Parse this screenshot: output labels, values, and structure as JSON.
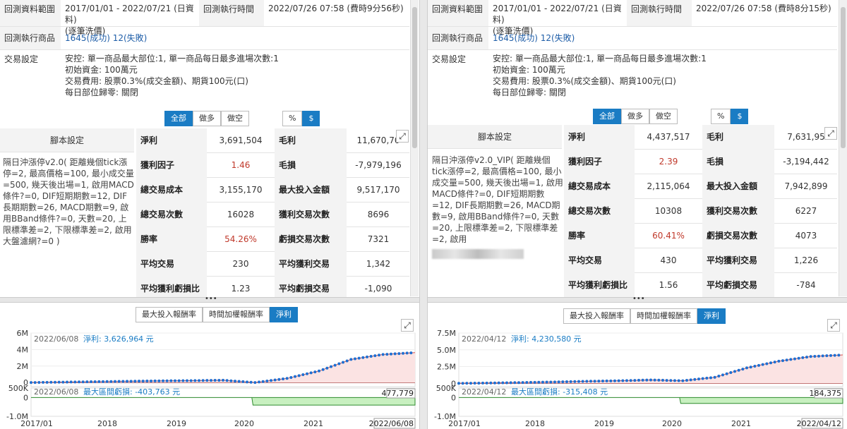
{
  "left": {
    "info": {
      "range_label": "回測資料範圍",
      "range_value": "2017/01/01 - 2022/07/21 (日資料)",
      "range_sub": "(逐筆洗價)",
      "exec_time_label": "回測執行時間",
      "exec_time_value": "2022/07/26 07:58 (費時9分56秒)",
      "products_label": "回測執行商品",
      "products_success": "1645(成功)",
      "products_fail": "12(失敗)",
      "trade_label": "交易設定",
      "trade_lines": [
        "安控: 單一商品最大部位:1, 單一商品每日最多進場次數:1",
        "初始資金: 100萬元",
        "交易費用: 股票0.3%(成交金額)、期貨100元(口)",
        "每日部位歸零: 關閉"
      ]
    },
    "filters": {
      "all": "全部",
      "long": "做多",
      "short": "做空",
      "percent": "%",
      "dollar": "$"
    },
    "script_header": "腳本設定",
    "script_desc": "隔日沖漲停v2.0( 距離幾個tick漲停=2, 最高價格=100, 最小成交量=500, 幾天後出場=1, 啟用MACD條件?=0, DIF短期期數=12, DIF長期期數=26, MACD期數=9, 啟用BBand條件?=0, 天數=20, 上限標準差=2, 下限標準差=2, 啟用大盤濾網?=0 )",
    "stats": [
      {
        "l1": "淨利",
        "v1": "3,691,504",
        "l2": "毛利",
        "v2": "11,670,70"
      },
      {
        "l1": "獲利因子",
        "v1": "1.46",
        "l2": "毛損",
        "v2": "-7,979,196"
      },
      {
        "l1": "總交易成本",
        "v1": "3,155,170",
        "l2": "最大投入金額",
        "v2": "9,517,170"
      },
      {
        "l1": "總交易次數",
        "v1": "16028",
        "l2": "獲利交易次數",
        "v2": "8696"
      },
      {
        "l1": "勝率",
        "v1": "54.26%",
        "l2": "虧損交易次數",
        "v2": "7321"
      },
      {
        "l1": "平均交易",
        "v1": "230",
        "l2": "平均獲利交易",
        "v2": "1,342"
      },
      {
        "l1": "平均獲利虧損比",
        "v1": "1.23",
        "l2": "平均虧損交易",
        "v2": "-1,090"
      }
    ],
    "chart_tabs": [
      "最大投入報酬率",
      "時間加權報酬率",
      "淨利"
    ],
    "top_legend_date": "2022/06/08",
    "top_legend_text": "淨利: 3,626,964 元",
    "bottom_legend_date": "2022/06/08",
    "bottom_legend_text": "最大區間虧損: -403,763 元",
    "dd_label": "477,779",
    "x_end_label": "2022/06/08"
  },
  "right": {
    "info": {
      "range_label": "回測資料範圍",
      "range_value": "2017/01/01 - 2022/07/21 (日資料)",
      "range_sub": "(逐筆洗價)",
      "exec_time_label": "回測執行時間",
      "exec_time_value": "2022/07/26 07:58 (費時8分15秒)",
      "products_label": "回測執行商品",
      "products_success": "1645(成功)",
      "products_fail": "12(失敗)",
      "trade_label": "交易設定",
      "trade_lines": [
        "安控: 單一商品最大部位:1, 單一商品每日最多進場次數:1",
        "初始資金: 100萬元",
        "交易費用: 股票0.3%(成交金額)、期貨100元(口)",
        "每日部位歸零: 關閉"
      ]
    },
    "filters": {
      "all": "全部",
      "long": "做多",
      "short": "做空",
      "percent": "%",
      "dollar": "$"
    },
    "script_header": "腳本設定",
    "script_desc": "隔日沖漲停v2.0_VIP( 距離幾個tick漲停=2, 最高價格=100, 最小成交量=500, 幾天後出場=1, 啟用MACD條件?=0, DIF短期期數=12, DIF長期期數=26, MACD期數=9, 啟用BBand條件?=0, 天數=20, 上限標準差=2, 下限標準差=2, 啟用",
    "stats": [
      {
        "l1": "淨利",
        "v1": "4,437,517",
        "l2": "毛利",
        "v2": "7,631,95"
      },
      {
        "l1": "獲利因子",
        "v1": "2.39",
        "l2": "毛損",
        "v2": "-3,194,442"
      },
      {
        "l1": "總交易成本",
        "v1": "2,115,064",
        "l2": "最大投入金額",
        "v2": "7,942,899"
      },
      {
        "l1": "總交易次數",
        "v1": "10308",
        "l2": "獲利交易次數",
        "v2": "6227"
      },
      {
        "l1": "勝率",
        "v1": "60.41%",
        "l2": "虧損交易次數",
        "v2": "4073"
      },
      {
        "l1": "平均交易",
        "v1": "430",
        "l2": "平均獲利交易",
        "v2": "1,226"
      },
      {
        "l1": "平均獲利虧損比",
        "v1": "1.56",
        "l2": "平均虧損交易",
        "v2": "-784"
      }
    ],
    "chart_tabs": [
      "最大投入報酬率",
      "時間加權報酬率",
      "淨利"
    ],
    "top_legend_date": "2022/04/12",
    "top_legend_text": "淨利: 4,230,580 元",
    "bottom_legend_date": "2022/04/12",
    "bottom_legend_text": "最大區間虧損: -315,408 元",
    "dd_label": "184,375",
    "x_end_label": "2022/04/12"
  },
  "colors": {
    "accent": "#1a7cc4",
    "link": "#1f5ea8",
    "red": "#c0392b",
    "equity": "#1f6fd1",
    "drawdown_fill": "#c8f0c0",
    "drawdown_line": "#2e8b2e"
  },
  "chart_data": [
    {
      "type": "line",
      "x": [
        "2017/01",
        "2017/07",
        "2018/01",
        "2018/07",
        "2019/01",
        "2019/07",
        "2020/01",
        "2020/04",
        "2020/07",
        "2021/01",
        "2021/07",
        "2022/01",
        "2022/06"
      ],
      "series": [
        {
          "name": "淨利",
          "values": [
            0,
            50000,
            100000,
            150000,
            200000,
            230000,
            280000,
            0,
            500000,
            1400000,
            2800000,
            3400000,
            3626964
          ]
        }
      ],
      "y_ticks": [
        "6M",
        "4M",
        "2M",
        "0"
      ],
      "x_ticks": [
        "2017/01",
        "2018",
        "2019",
        "2020",
        "2021",
        "2022/06/08"
      ],
      "ylim": [
        -500000,
        6000000
      ]
    },
    {
      "type": "area",
      "x": [
        "2017/01",
        "2020/03",
        "2020/04",
        "2022/06"
      ],
      "series": [
        {
          "name": "最大區間虧損",
          "values": [
            0,
            0,
            -403763,
            -403763
          ]
        }
      ],
      "y_ticks": [
        "500K",
        "0",
        "-1.0M"
      ],
      "ylim": [
        -1000000,
        500000
      ]
    },
    {
      "type": "line",
      "x": [
        "2017/01",
        "2017/07",
        "2018/01",
        "2018/07",
        "2019/01",
        "2019/07",
        "2020/01",
        "2020/04",
        "2020/07",
        "2021/01",
        "2021/07",
        "2022/01",
        "2022/04"
      ],
      "series": [
        {
          "name": "淨利",
          "values": [
            0,
            50000,
            120000,
            200000,
            300000,
            380000,
            500000,
            380000,
            900000,
            2300000,
            3300000,
            4000000,
            4230580
          ]
        }
      ],
      "y_ticks": [
        "7.5M",
        "5.0M",
        "2.5M",
        "0"
      ],
      "x_ticks": [
        "2017/01",
        "2018",
        "2019",
        "2020",
        "2021",
        "2022/04/12"
      ],
      "ylim": [
        -500000,
        7500000
      ]
    },
    {
      "type": "area",
      "x": [
        "2017/01",
        "2020/03",
        "2020/04",
        "2022/04"
      ],
      "series": [
        {
          "name": "最大區間虧損",
          "values": [
            0,
            0,
            -315408,
            -315408
          ]
        }
      ],
      "y_ticks": [
        "500K",
        "0",
        "-1.0M"
      ],
      "ylim": [
        -1000000,
        500000
      ]
    }
  ]
}
